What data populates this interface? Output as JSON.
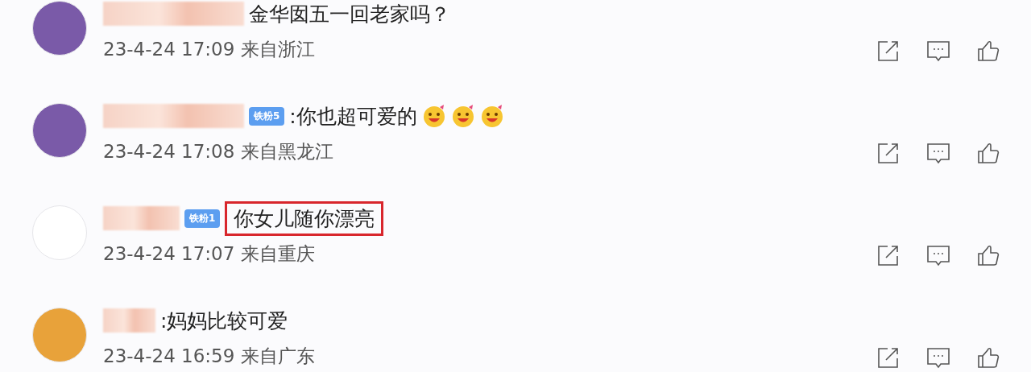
{
  "comments": [
    {
      "kind": "portrait",
      "text": "金华囡五一回老家吗？",
      "highlighted": false,
      "time": "23-4-24 17:09",
      "location": "来自浙江"
    },
    {
      "kind": "portrait",
      "badge": "铁粉5",
      "text": ":你也超可爱的",
      "emojis": [
        {
          "kind": "laugh"
        },
        {
          "kind": "laugh"
        },
        {
          "kind": "laugh"
        }
      ],
      "highlighted": false,
      "time": "23-4-24 17:08",
      "location": "来自黑龙江"
    },
    {
      "kind": "logo",
      "badge": "铁粉1",
      "text": "你女儿随你漂亮",
      "highlighted": true,
      "time": "23-4-24 17:07",
      "location": "来自重庆"
    },
    {
      "kind": "landscape",
      "text": ":妈妈比较可爱",
      "highlighted": false,
      "time": "23-4-24 16:59",
      "location": "来自广东"
    }
  ]
}
